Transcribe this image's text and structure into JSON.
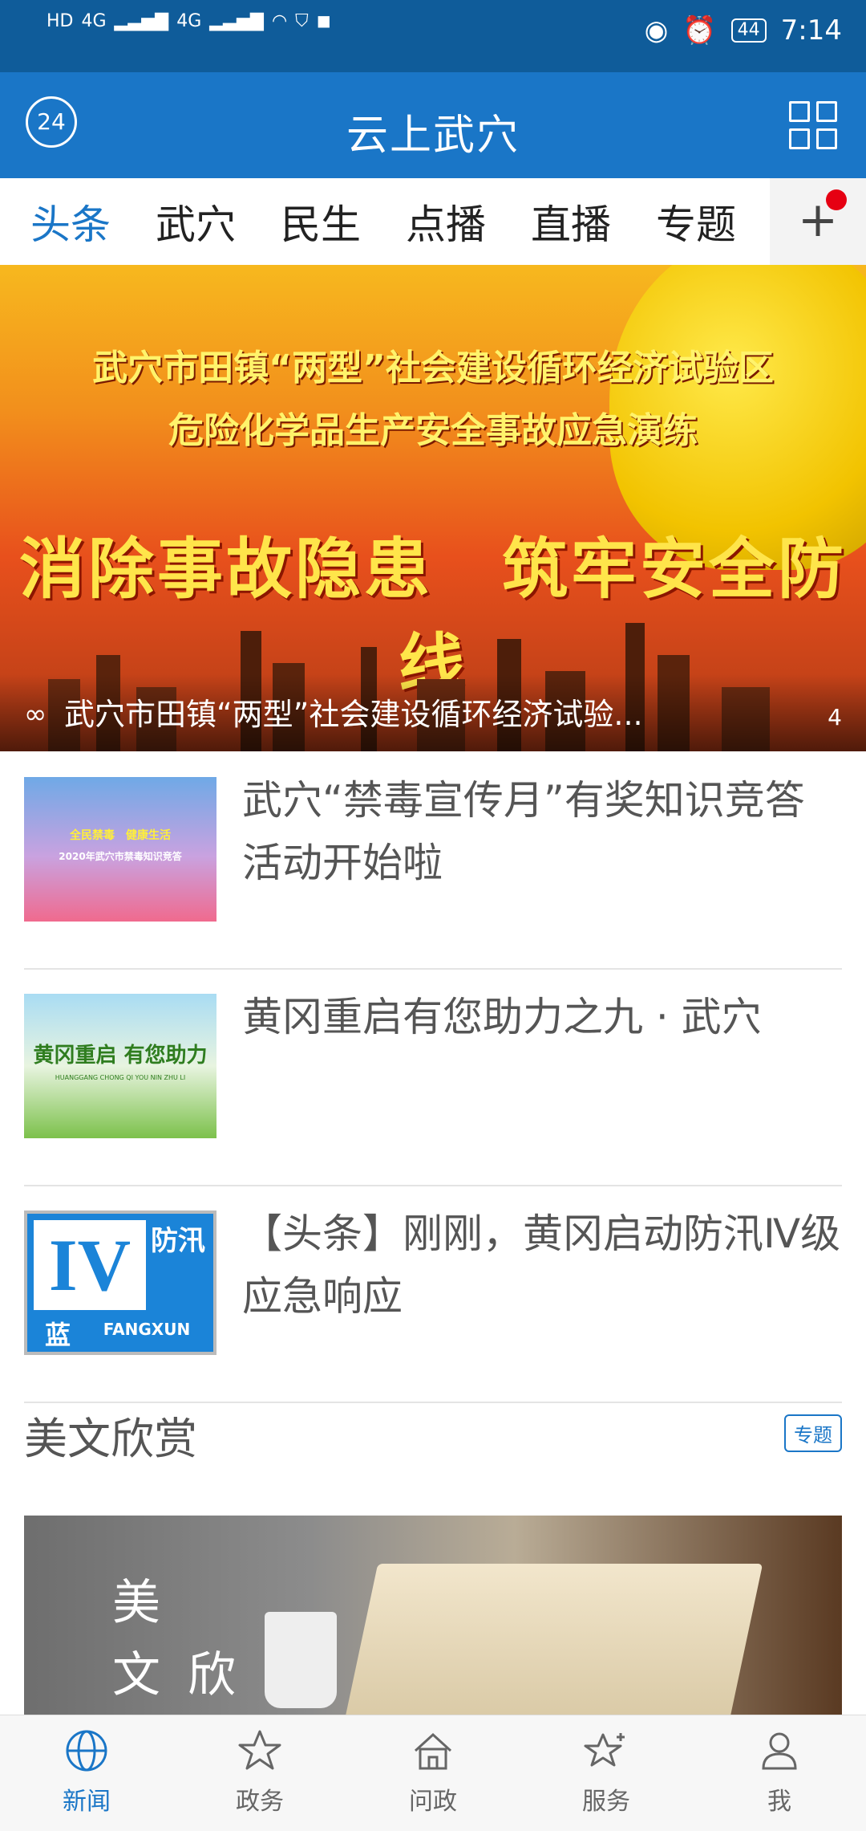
{
  "status_bar": {
    "left_labels": [
      "HD",
      "4G",
      "4G"
    ],
    "battery": "44",
    "time": "7:14"
  },
  "app_bar": {
    "logo_text": "24",
    "title": "云上武穴"
  },
  "tabs": [
    {
      "label": "头条",
      "active": true
    },
    {
      "label": "武穴"
    },
    {
      "label": "民生"
    },
    {
      "label": "点播"
    },
    {
      "label": "直播"
    },
    {
      "label": "专题"
    }
  ],
  "banner": {
    "line1": "武穴市田镇“两型”社会建设循环经济试验区",
    "line2": "危险化学品生产安全事故应急演练",
    "line3": "消除事故隐患　筑牢安全防线",
    "caption": "武穴市田镇“两型”社会建设循环经济试验...",
    "page_count": "4"
  },
  "news": [
    {
      "title": "武穴“禁毒宣传月”有奖知识竞答活动开始啦",
      "thumb": {
        "top": "全民禁毒　健康生活",
        "sub": "2020年武穴市禁毒知识竞答"
      }
    },
    {
      "title": "黄冈重启有您助力之九 · 武穴",
      "thumb": {
        "top": "黄冈重启 有您助力",
        "sub": "HUANGGANG CHONG QI YOU NIN ZHU LI"
      }
    },
    {
      "title": "【头条】刚刚，黄冈启动防汛Ⅳ级应急响应",
      "thumb": {
        "big": "IV",
        "right_top": "防汛",
        "left_bottom": "蓝",
        "right_bottom": "FANGXUN"
      }
    }
  ],
  "section": {
    "title": "美文欣赏",
    "badge": "专题"
  },
  "feature": {
    "char1": "美",
    "char2": "文",
    "char3": "欣"
  },
  "bottom_nav": [
    {
      "label": "新闻",
      "icon": "globe-icon",
      "active": true
    },
    {
      "label": "政务",
      "icon": "star-icon"
    },
    {
      "label": "问政",
      "icon": "home-icon"
    },
    {
      "label": "服务",
      "icon": "sparkle-star-icon"
    },
    {
      "label": "我",
      "icon": "person-icon"
    }
  ],
  "colors": {
    "primary": "#1a76c7",
    "status_bar": "#0f5c9a",
    "notification_dot": "#e60012"
  }
}
